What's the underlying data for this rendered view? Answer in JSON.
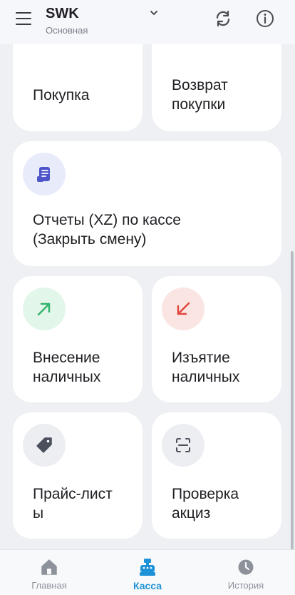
{
  "header": {
    "title": "SWK",
    "subtitle": "Основная"
  },
  "cards": {
    "purchase": "Покупка",
    "return_line1": "Возврат",
    "return_line2": "покупки",
    "reports_line1": "Отчеты (XZ) по кассе",
    "reports_line2": "(Закрыть смену)",
    "deposit_line1": "Внесение",
    "deposit_line2": "наличных",
    "withdraw_line1": "Изъятие",
    "withdraw_line2": "наличных",
    "price_line1": "Прайс-лист",
    "price_line2": "ы",
    "excise_line1": "Проверка",
    "excise_line2": "акциз"
  },
  "nav": {
    "home": "Главная",
    "kassa": "Касса",
    "history": "История"
  },
  "colors": {
    "accent": "#1e92d6",
    "deposit_green": "#2fb36a",
    "withdraw_red": "#e0473c",
    "report_indigo": "#4d55c9"
  },
  "icons": {
    "menu": "menu-icon",
    "refresh": "refresh-icon",
    "info": "info-icon",
    "report": "receipt-icon",
    "deposit": "arrow-up-right-icon",
    "withdraw": "arrow-down-left-icon",
    "price": "tag-icon",
    "excise": "scan-icon",
    "home": "home-icon",
    "kassa": "cash-register-icon",
    "history": "clock-icon"
  }
}
